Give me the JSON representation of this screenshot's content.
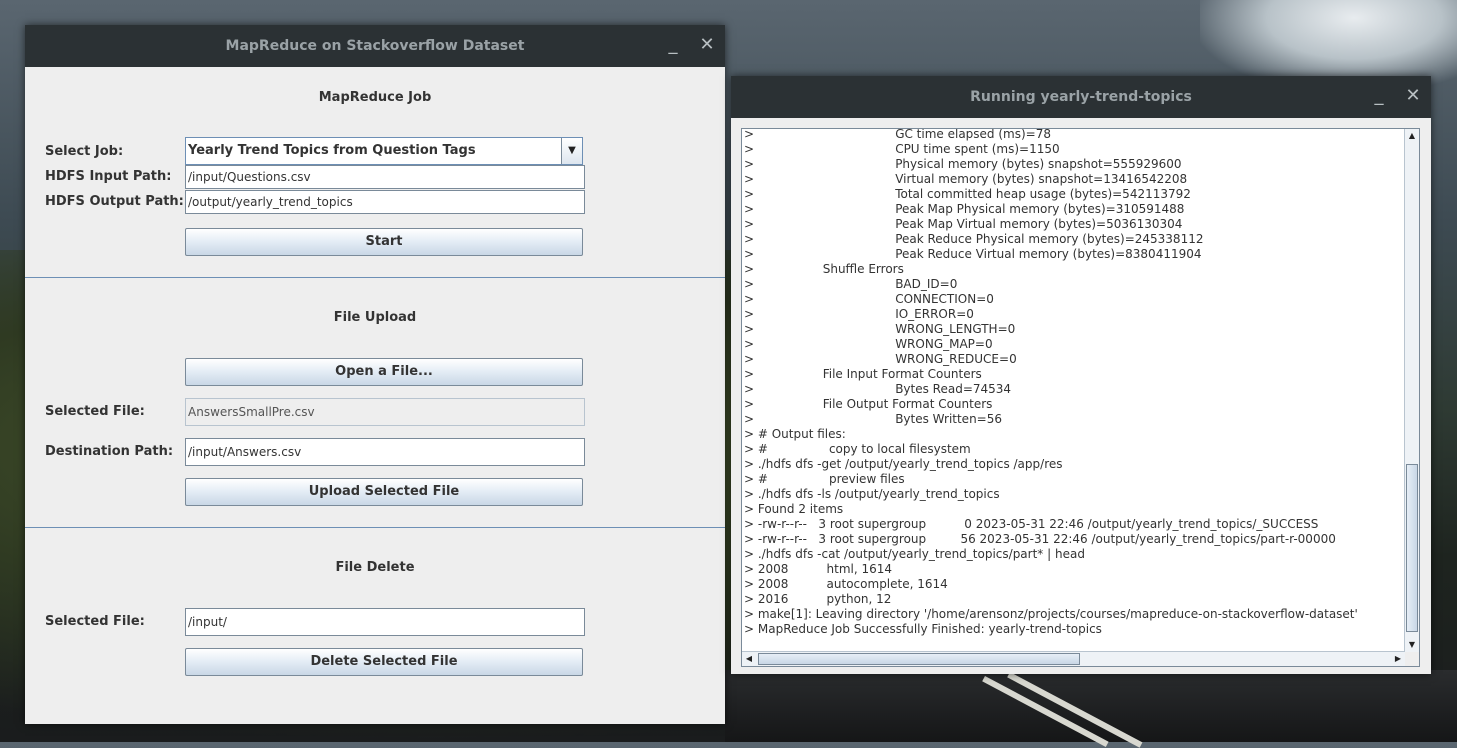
{
  "left_window": {
    "title": "MapReduce on Stackoverflow Dataset",
    "minimize_glyph": "_",
    "close_glyph": "✕",
    "job": {
      "title": "MapReduce Job",
      "select_label": "Select Job:",
      "select_value": "Yearly Trend Topics from Question Tags",
      "input_label": "HDFS Input Path:",
      "input_value": "/input/Questions.csv",
      "output_label": "HDFS Output Path:",
      "output_value": "/output/yearly_trend_topics",
      "start_label": "Start"
    },
    "upload": {
      "title": "File Upload",
      "open_label": "Open a File...",
      "selected_label": "Selected File:",
      "selected_value": "AnswersSmallPre.csv",
      "dest_label": "Destination Path:",
      "dest_value": "/input/Answers.csv",
      "upload_label": "Upload Selected File"
    },
    "delete": {
      "title": "File Delete",
      "selected_label": "Selected File:",
      "selected_value": "/input/",
      "delete_label": "Delete Selected File"
    }
  },
  "right_window": {
    "title": "Running yearly-trend-topics",
    "minimize_glyph": "_",
    "close_glyph": "✕",
    "console_lines": [
      ">                                     GC time elapsed (ms)=78",
      ">                                     CPU time spent (ms)=1150",
      ">                                     Physical memory (bytes) snapshot=555929600",
      ">                                     Virtual memory (bytes) snapshot=13416542208",
      ">                                     Total committed heap usage (bytes)=542113792",
      ">                                     Peak Map Physical memory (bytes)=310591488",
      ">                                     Peak Map Virtual memory (bytes)=5036130304",
      ">                                     Peak Reduce Physical memory (bytes)=245338112",
      ">                                     Peak Reduce Virtual memory (bytes)=8380411904",
      ">                  Shuffle Errors",
      ">                                     BAD_ID=0",
      ">                                     CONNECTION=0",
      ">                                     IO_ERROR=0",
      ">                                     WRONG_LENGTH=0",
      ">                                     WRONG_MAP=0",
      ">                                     WRONG_REDUCE=0",
      ">                  File Input Format Counters",
      ">                                     Bytes Read=74534",
      ">                  File Output Format Counters",
      ">                                     Bytes Written=56",
      "> # Output files:",
      "> #                copy to local filesystem",
      "> ./hdfs dfs -get /output/yearly_trend_topics /app/res",
      "> #                preview files",
      "> ./hdfs dfs -ls /output/yearly_trend_topics",
      "> Found 2 items",
      "> -rw-r--r--   3 root supergroup          0 2023-05-31 22:46 /output/yearly_trend_topics/_SUCCESS",
      "> -rw-r--r--   3 root supergroup         56 2023-05-31 22:46 /output/yearly_trend_topics/part-r-00000",
      "> ./hdfs dfs -cat /output/yearly_trend_topics/part* | head",
      "> 2008          html, 1614",
      "> 2008          autocomplete, 1614",
      "> 2016          python, 12",
      "> make[1]: Leaving directory '/home/arensonz/projects/courses/mapreduce-on-stackoverflow-dataset'",
      "> MapReduce Job Successfully Finished: yearly-trend-topics"
    ]
  }
}
